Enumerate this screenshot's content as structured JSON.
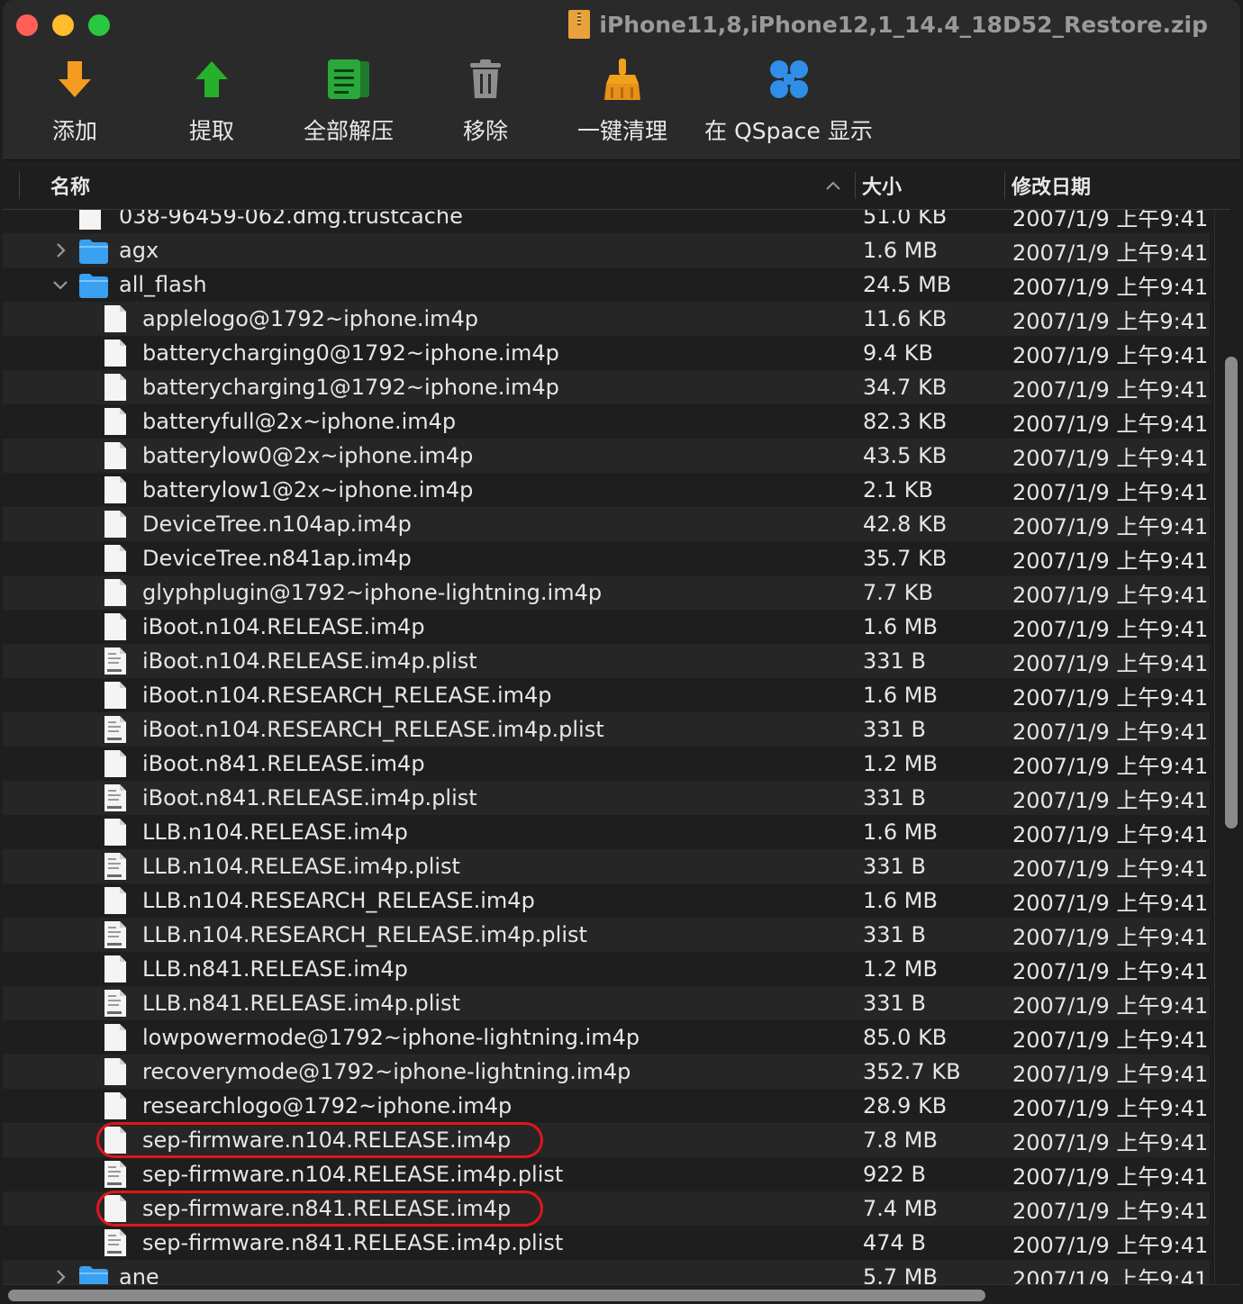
{
  "window": {
    "title": "iPhone11,8,iPhone12,1_14.4_18D52_Restore.zip"
  },
  "toolbar": {
    "add_label": "添加",
    "extract_label": "提取",
    "extract_all_label": "全部解压",
    "remove_label": "移除",
    "clean_label": "一键清理",
    "qspace_label": "在 QSpace 显示"
  },
  "columns": {
    "name": "名称",
    "size": "大小",
    "date": "修改日期",
    "sort_indicator": "^"
  },
  "colors": {
    "highlight": "#e0161c",
    "folder": "#3aa0f0"
  },
  "rows": [
    {
      "name": "038-96459-062.dmg.trustcache",
      "size": "51.0 KB",
      "date": "2007/1/9 上午9:41",
      "type": "file",
      "level": 0
    },
    {
      "name": "agx",
      "size": "1.6 MB",
      "date": "2007/1/9 上午9:41",
      "type": "folder",
      "level": 0,
      "expanded": false
    },
    {
      "name": "all_flash",
      "size": "24.5 MB",
      "date": "2007/1/9 上午9:41",
      "type": "folder",
      "level": 0,
      "expanded": true
    },
    {
      "name": "applelogo@1792~iphone.im4p",
      "size": "11.6 KB",
      "date": "2007/1/9 上午9:41",
      "type": "file",
      "level": 1
    },
    {
      "name": "batterycharging0@1792~iphone.im4p",
      "size": "9.4 KB",
      "date": "2007/1/9 上午9:41",
      "type": "file",
      "level": 1
    },
    {
      "name": "batterycharging1@1792~iphone.im4p",
      "size": "34.7 KB",
      "date": "2007/1/9 上午9:41",
      "type": "file",
      "level": 1
    },
    {
      "name": "batteryfull@2x~iphone.im4p",
      "size": "82.3 KB",
      "date": "2007/1/9 上午9:41",
      "type": "file",
      "level": 1
    },
    {
      "name": "batterylow0@2x~iphone.im4p",
      "size": "43.5 KB",
      "date": "2007/1/9 上午9:41",
      "type": "file",
      "level": 1
    },
    {
      "name": "batterylow1@2x~iphone.im4p",
      "size": "2.1 KB",
      "date": "2007/1/9 上午9:41",
      "type": "file",
      "level": 1
    },
    {
      "name": "DeviceTree.n104ap.im4p",
      "size": "42.8 KB",
      "date": "2007/1/9 上午9:41",
      "type": "file",
      "level": 1
    },
    {
      "name": "DeviceTree.n841ap.im4p",
      "size": "35.7 KB",
      "date": "2007/1/9 上午9:41",
      "type": "file",
      "level": 1
    },
    {
      "name": "glyphplugin@1792~iphone-lightning.im4p",
      "size": "7.7 KB",
      "date": "2007/1/9 上午9:41",
      "type": "file",
      "level": 1
    },
    {
      "name": "iBoot.n104.RELEASE.im4p",
      "size": "1.6 MB",
      "date": "2007/1/9 上午9:41",
      "type": "file",
      "level": 1
    },
    {
      "name": "iBoot.n104.RELEASE.im4p.plist",
      "size": "331 B",
      "date": "2007/1/9 上午9:41",
      "type": "plist",
      "level": 1
    },
    {
      "name": "iBoot.n104.RESEARCH_RELEASE.im4p",
      "size": "1.6 MB",
      "date": "2007/1/9 上午9:41",
      "type": "file",
      "level": 1
    },
    {
      "name": "iBoot.n104.RESEARCH_RELEASE.im4p.plist",
      "size": "331 B",
      "date": "2007/1/9 上午9:41",
      "type": "plist",
      "level": 1
    },
    {
      "name": "iBoot.n841.RELEASE.im4p",
      "size": "1.2 MB",
      "date": "2007/1/9 上午9:41",
      "type": "file",
      "level": 1
    },
    {
      "name": "iBoot.n841.RELEASE.im4p.plist",
      "size": "331 B",
      "date": "2007/1/9 上午9:41",
      "type": "plist",
      "level": 1
    },
    {
      "name": "LLB.n104.RELEASE.im4p",
      "size": "1.6 MB",
      "date": "2007/1/9 上午9:41",
      "type": "file",
      "level": 1
    },
    {
      "name": "LLB.n104.RELEASE.im4p.plist",
      "size": "331 B",
      "date": "2007/1/9 上午9:41",
      "type": "plist",
      "level": 1
    },
    {
      "name": "LLB.n104.RESEARCH_RELEASE.im4p",
      "size": "1.6 MB",
      "date": "2007/1/9 上午9:41",
      "type": "file",
      "level": 1
    },
    {
      "name": "LLB.n104.RESEARCH_RELEASE.im4p.plist",
      "size": "331 B",
      "date": "2007/1/9 上午9:41",
      "type": "plist",
      "level": 1
    },
    {
      "name": "LLB.n841.RELEASE.im4p",
      "size": "1.2 MB",
      "date": "2007/1/9 上午9:41",
      "type": "file",
      "level": 1
    },
    {
      "name": "LLB.n841.RELEASE.im4p.plist",
      "size": "331 B",
      "date": "2007/1/9 上午9:41",
      "type": "plist",
      "level": 1
    },
    {
      "name": "lowpowermode@1792~iphone-lightning.im4p",
      "size": "85.0 KB",
      "date": "2007/1/9 上午9:41",
      "type": "file",
      "level": 1
    },
    {
      "name": "recoverymode@1792~iphone-lightning.im4p",
      "size": "352.7 KB",
      "date": "2007/1/9 上午9:41",
      "type": "file",
      "level": 1
    },
    {
      "name": "researchlogo@1792~iphone.im4p",
      "size": "28.9 KB",
      "date": "2007/1/9 上午9:41",
      "type": "file",
      "level": 1
    },
    {
      "name": "sep-firmware.n104.RELEASE.im4p",
      "size": "7.8 MB",
      "date": "2007/1/9 上午9:41",
      "type": "file",
      "level": 1,
      "highlighted": true
    },
    {
      "name": "sep-firmware.n104.RELEASE.im4p.plist",
      "size": "922 B",
      "date": "2007/1/9 上午9:41",
      "type": "plist",
      "level": 1
    },
    {
      "name": "sep-firmware.n841.RELEASE.im4p",
      "size": "7.4 MB",
      "date": "2007/1/9 上午9:41",
      "type": "file",
      "level": 1,
      "highlighted": true
    },
    {
      "name": "sep-firmware.n841.RELEASE.im4p.plist",
      "size": "474 B",
      "date": "2007/1/9 上午9:41",
      "type": "plist",
      "level": 1
    },
    {
      "name": "ane",
      "size": "5.7 MB",
      "date": "2007/1/9 上午9:41",
      "type": "folder",
      "level": 0,
      "expanded": false
    }
  ]
}
